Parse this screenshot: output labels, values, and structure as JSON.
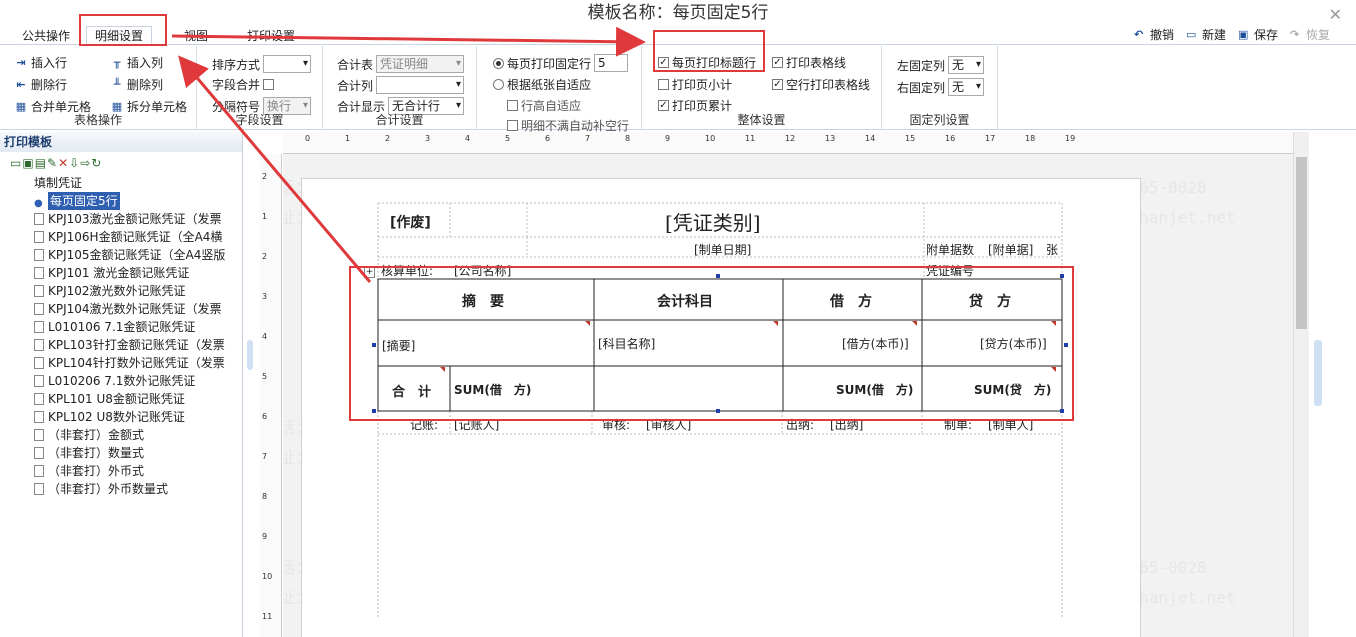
{
  "window": {
    "title": "模板名称：每页固定5行"
  },
  "tabs": [
    {
      "label": "公共操作"
    },
    {
      "label": "明细设置"
    },
    {
      "label": "视图"
    },
    {
      "label": "打印设置"
    }
  ],
  "toolbar_right": {
    "undo": "撤销",
    "new": "新建",
    "save": "保存",
    "redo": "恢复"
  },
  "ribbon": {
    "table_ops": {
      "label": "表格操作",
      "insert_row": "插入行",
      "insert_col": "插入列",
      "delete_row": "删除行",
      "delete_col": "删除列",
      "merge": "合并单元格",
      "split": "拆分单元格"
    },
    "field": {
      "label": "字段设置",
      "sort_label": "排序方式",
      "sort_value": "",
      "merge_label": "字段合并",
      "sep_label": "分隔符号",
      "sep_value": "换行"
    },
    "total": {
      "label": "合计设置",
      "table_label": "合计表",
      "table_value": "凭证明细",
      "col_label": "合计列",
      "col_value": "",
      "display_label": "合计显示",
      "display_value": "无合计行"
    },
    "fixed": {
      "fixed_rows_label": "每页打印固定行",
      "fixed_rows_value": "5",
      "auto_label": "根据纸张自适应",
      "row_height": "行高自适应",
      "fill_rows": "明细不满自动补空行"
    },
    "overall": {
      "label": "整体设置",
      "print_title": "每页打印标题行",
      "print_subtotal": "打印页小计",
      "print_cumulative": "打印页累计",
      "print_grid": "打印表格线",
      "blank_grid": "空行打印表格线"
    },
    "fixedcol": {
      "label": "固定列设置",
      "left_label": "左固定列",
      "left_value": "无",
      "right_label": "右固定列",
      "right_value": "无"
    }
  },
  "left_panel": {
    "title": "打印模板",
    "root": "填制凭证",
    "items": [
      "每页固定5行",
      "KPJ103激光金额记账凭证（发票",
      "KPJ106H金额记账凭证（全A4横",
      "KPJ105金额记账凭证（全A4竖版",
      "KPJ101 激光金额记账凭证",
      "KPJ102激光数外记账凭证",
      "KPJ104激光数外记账凭证（发票",
      "L010106 7.1金额记账凭证",
      "KPL103针打金额记账凭证（发票",
      "KPL104针打数外记账凭证（发票",
      "L010206 7.1数外记账凭证",
      "KPL101 U8金额记账凭证",
      "KPL102 U8数外记账凭证",
      "（非套打）金额式",
      "（非套打）数量式",
      "（非套打）外币式",
      "（非套打）外币数量式"
    ]
  },
  "ruler": {
    "top": [
      "0",
      "1",
      "2",
      "3",
      "4",
      "5",
      "6",
      "7",
      "8",
      "9",
      "10",
      "11",
      "12",
      "13",
      "14",
      "15",
      "16",
      "17",
      "18",
      "19"
    ],
    "left": [
      "2",
      "1",
      "2",
      "3",
      "4",
      "5",
      "6",
      "7",
      "8",
      "9",
      "10",
      "11"
    ]
  },
  "voucher": {
    "void": "[作废]",
    "title": "[凭证类别]",
    "date": "[制单日期]",
    "attach": "附单据数",
    "attach_field": "[附单据]",
    "attach_unit": "张",
    "unit_label": "核算单位:",
    "unit_field": "[公司名称]",
    "voucher_no": "凭证编号",
    "headers": [
      "摘　要",
      "会计科目",
      "借　方",
      "贷　方"
    ],
    "detail": [
      "[摘要]",
      "[科目名称]",
      "[借方(本币)]",
      "[贷方(本币)]"
    ],
    "total": [
      "合　计",
      "SUM(借　方)",
      "SUM(借　方)",
      "SUM(贷　方)"
    ],
    "footer": [
      "记账:",
      "[记账人]",
      "审核:",
      "[审核人]",
      "出纳:",
      "[出纳]",
      "制单:",
      "[制单人]"
    ]
  },
  "watermark": {
    "phone": "电话：400-665-0028",
    "site": "网址：www.chanjet.net"
  }
}
